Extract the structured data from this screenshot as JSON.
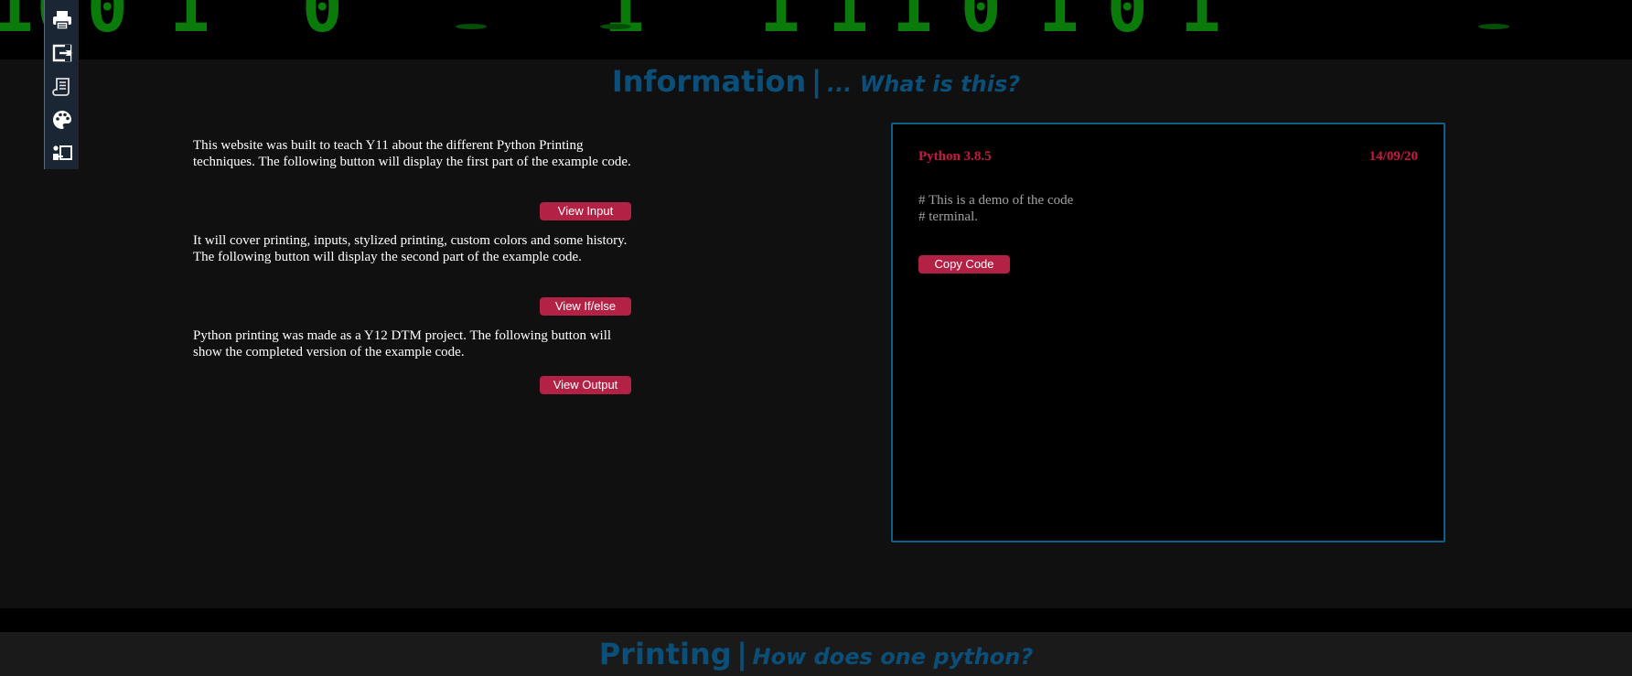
{
  "banner": {
    "digits": [
      "1",
      "0",
      "0",
      "1",
      "0",
      "1",
      "1",
      "1",
      "1",
      "0",
      "1",
      "0",
      "1"
    ]
  },
  "sidebar": {
    "items": [
      {
        "icon": "printer-icon"
      },
      {
        "icon": "input-icon"
      },
      {
        "icon": "scroll-icon"
      },
      {
        "icon": "palette-icon"
      },
      {
        "icon": "history-icon"
      }
    ]
  },
  "info_section": {
    "title": "Information",
    "separator": "|",
    "subtitle": "... What is this?",
    "paragraphs": [
      "This website was built to teach Y11 about the different Python Printing techniques. The following button will display the first part of the example code.",
      "It will cover printing, inputs, stylized printing, custom colors and some history. The following button will display the second part of the example code.",
      "Python printing was made as a Y12 DTM project. The following button will show the completed version of the example code."
    ],
    "buttons": [
      "View Input",
      "View If/else",
      "View Output"
    ]
  },
  "terminal": {
    "version": "Python 3.8.5",
    "date": "14/09/20",
    "code_lines": [
      "# This is a demo of the code",
      "# terminal."
    ],
    "copy_label": "Copy Code",
    "border_color": "#0d5f86"
  },
  "print_section": {
    "title": "Printing",
    "separator": "|",
    "subtitle": "How does one python?"
  },
  "colors": {
    "accent": "#b32145",
    "heading": "#0b4f78",
    "terminal_label": "#c81a40",
    "binary_green": "#0a7a0a"
  }
}
